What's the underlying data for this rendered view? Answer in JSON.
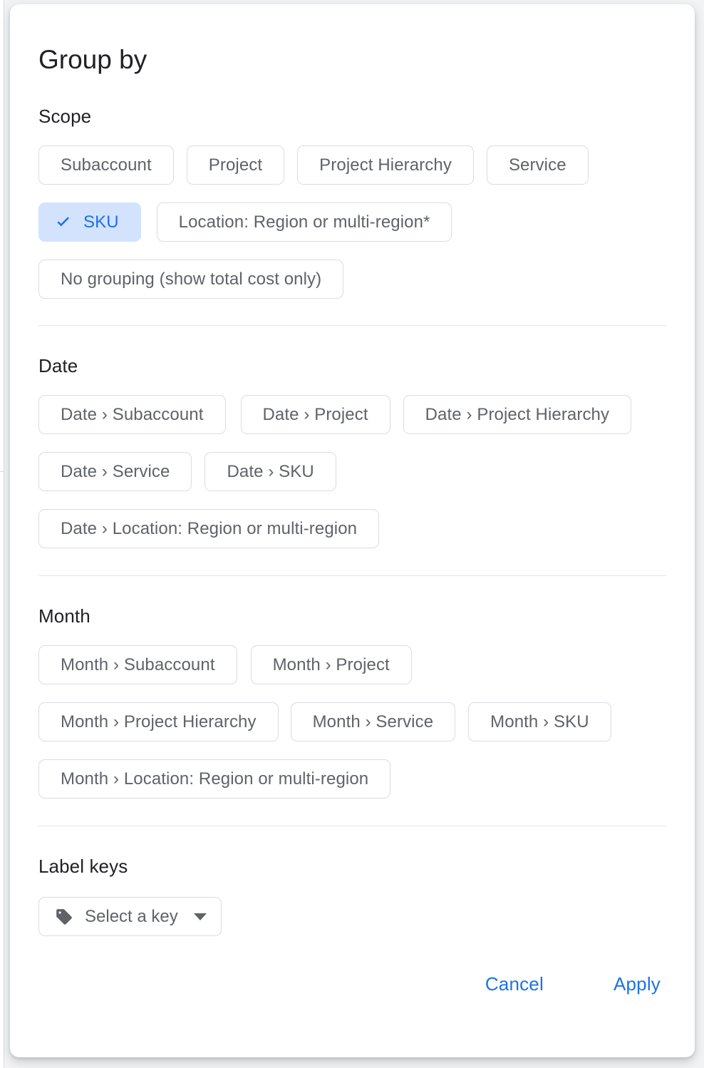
{
  "dialog": {
    "title": "Group by"
  },
  "sections": [
    {
      "id": "scope",
      "heading": "Scope",
      "chips": [
        {
          "label": "Subaccount",
          "selected": false
        },
        {
          "label": "Project",
          "selected": false
        },
        {
          "label": "Project Hierarchy",
          "selected": false
        },
        {
          "label": "Service",
          "selected": false
        },
        {
          "label": "SKU",
          "selected": true
        },
        {
          "label": "Location: Region or multi-region*",
          "selected": false
        },
        {
          "label": "No grouping (show total cost only)",
          "selected": false
        }
      ]
    },
    {
      "id": "date",
      "heading": "Date",
      "chips": [
        {
          "label": "Date › Subaccount",
          "selected": false
        },
        {
          "label": "Date › Project",
          "selected": false
        },
        {
          "label": "Date › Project Hierarchy",
          "selected": false
        },
        {
          "label": "Date › Service",
          "selected": false
        },
        {
          "label": "Date › SKU",
          "selected": false
        },
        {
          "label": "Date › Location: Region or multi-region",
          "selected": false
        }
      ]
    },
    {
      "id": "month",
      "heading": "Month",
      "chips": [
        {
          "label": "Month › Subaccount",
          "selected": false
        },
        {
          "label": "Month › Project",
          "selected": false
        },
        {
          "label": "Month › Project Hierarchy",
          "selected": false
        },
        {
          "label": "Month › Service",
          "selected": false
        },
        {
          "label": "Month › SKU",
          "selected": false
        },
        {
          "label": "Month › Location: Region or multi-region",
          "selected": false
        }
      ]
    }
  ],
  "label_keys": {
    "heading": "Label keys",
    "select_label": "Select a key",
    "icon": "tag-icon",
    "caret_icon": "chevron-down-icon"
  },
  "footer": {
    "cancel_label": "Cancel",
    "apply_label": "Apply"
  },
  "colors": {
    "accent": "#1a73e8",
    "selected_chip_bg": "#d3e3fd",
    "selected_chip_text": "#1b6ef3",
    "chip_border": "#dadce0",
    "chip_text": "#5f6368",
    "heading_text": "#202124",
    "divider": "#e4e6e8",
    "dialog_bg": "#ffffff",
    "page_bg": "#f1f3f4"
  }
}
